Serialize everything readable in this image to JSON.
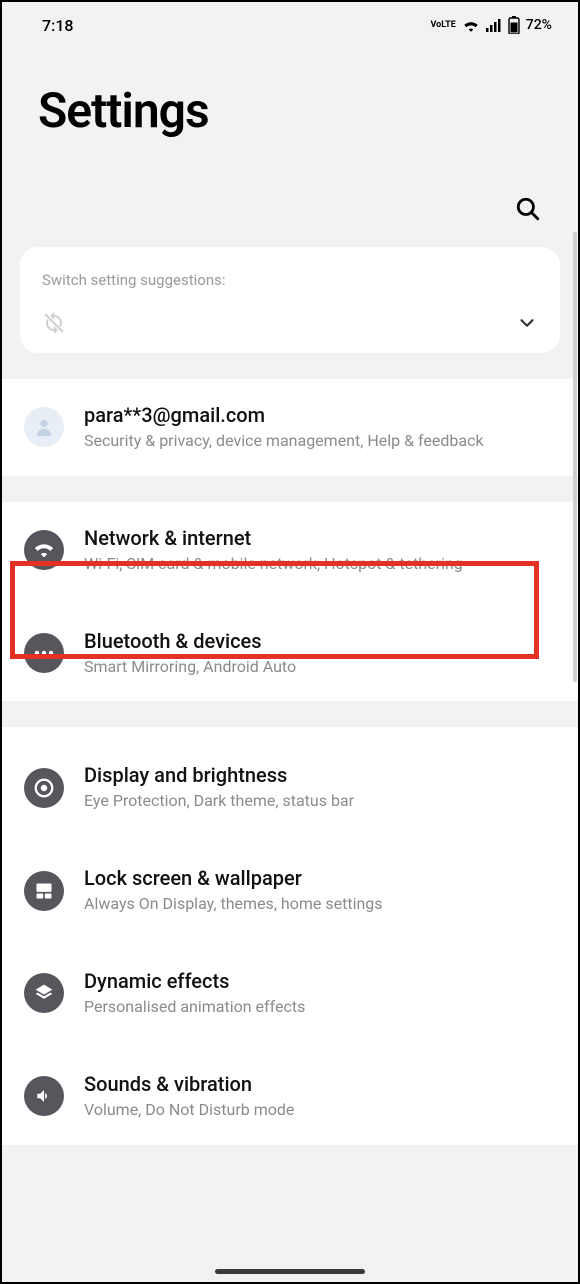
{
  "status": {
    "time": "7:18",
    "battery": "72%"
  },
  "header": {
    "title": "Settings"
  },
  "suggestions": {
    "label": "Switch setting suggestions:"
  },
  "account": {
    "email": "para**3@gmail.com",
    "sub": "Security & privacy, device management, Help & feedback"
  },
  "rows": {
    "network": {
      "title": "Network & internet",
      "sub": "Wi-Fi, SIM card & mobile network, Hotspot & tethering"
    },
    "bluetooth": {
      "title": "Bluetooth & devices",
      "sub": "Smart Mirroring, Android Auto"
    },
    "display": {
      "title": "Display and brightness",
      "sub": "Eye Protection, Dark theme, status bar"
    },
    "lockscreen": {
      "title": "Lock screen & wallpaper",
      "sub": "Always On Display, themes, home settings"
    },
    "dynamic": {
      "title": "Dynamic effects",
      "sub": "Personalised animation effects"
    },
    "sounds": {
      "title": "Sounds & vibration",
      "sub": "Volume, Do Not Disturb mode"
    }
  }
}
